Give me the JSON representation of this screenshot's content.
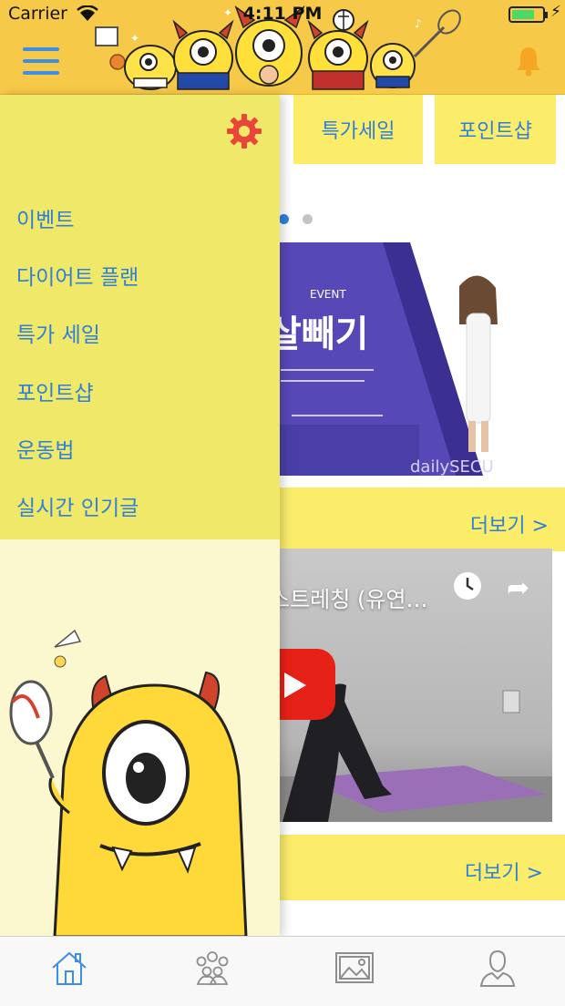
{
  "status_bar": {
    "carrier": "Carrier",
    "time": "4:11 PM",
    "battery_percent": 75
  },
  "header": {
    "menu_icon": "hamburger-icon",
    "bell_icon": "bell-icon",
    "mascot_image": "mascot-group-banner"
  },
  "top_tabs": [
    {
      "label": "특가세일"
    },
    {
      "label": "포인트샵"
    }
  ],
  "carousel": {
    "active_index": 0,
    "count": 2,
    "active_color": "#2f7fe0",
    "inactive_color": "#c4c4c4"
  },
  "banner": {
    "event_tag": "EVENT",
    "headline": "살빼기",
    "brand": "dailySECU"
  },
  "sections": [
    {
      "more_label": "더보기 >"
    },
    {
      "more_label": "더보기 >"
    }
  ],
  "video": {
    "title": "스트레칭 (유연…"
  },
  "drawer": {
    "settings_icon": "gear-icon",
    "items": [
      {
        "label": "이벤트"
      },
      {
        "label": "다이어트 플랜"
      },
      {
        "label": "특가 세일"
      },
      {
        "label": "포인트샵"
      },
      {
        "label": "운동법"
      },
      {
        "label": "실시간 인기글"
      }
    ]
  },
  "tab_bar": {
    "items": [
      {
        "icon": "home-icon",
        "active": true
      },
      {
        "icon": "community-icon",
        "active": false
      },
      {
        "icon": "gallery-icon",
        "active": false
      },
      {
        "icon": "profile-icon",
        "active": false
      }
    ]
  },
  "colors": {
    "header_bg": "#f7c948",
    "accent_blue": "#2f80d6",
    "drawer_bg": "#f0e868",
    "tab_yellow": "#fbec6a"
  }
}
